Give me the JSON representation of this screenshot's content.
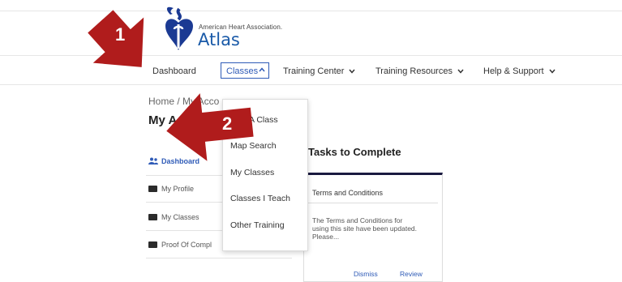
{
  "header": {
    "org_name": "American Heart Association.",
    "app_name": "Atlas"
  },
  "nav": {
    "dashboard": "Dashboard",
    "classes": "Classes",
    "training_center": "Training Center",
    "training_resources": "Training Resources",
    "help_support": "Help & Support"
  },
  "page": {
    "breadcrumb": "Home / My Acco",
    "title": "My A"
  },
  "sidebar": {
    "items": [
      {
        "label": "Dashboard"
      },
      {
        "label": "My Profile"
      },
      {
        "label": "My Classes"
      },
      {
        "label": "Proof Of Compl"
      }
    ]
  },
  "tasks": {
    "heading": "Tasks to Complete",
    "card_title": "Terms and Conditions",
    "card_text": "The Terms and Conditions for using this site have been updated. Please...",
    "dismiss": "Dismiss",
    "review": "Review"
  },
  "dropdown": {
    "items": [
      {
        "label": "A Class"
      },
      {
        "label": "Map Search"
      },
      {
        "label": "My Classes"
      },
      {
        "label": "Classes I Teach"
      },
      {
        "label": "Other Training"
      }
    ]
  },
  "callouts": {
    "one": "1",
    "two": "2"
  },
  "colors": {
    "accent": "#2f5bb7",
    "arrow": "#b01c1c",
    "logo": "#1b3a93"
  }
}
